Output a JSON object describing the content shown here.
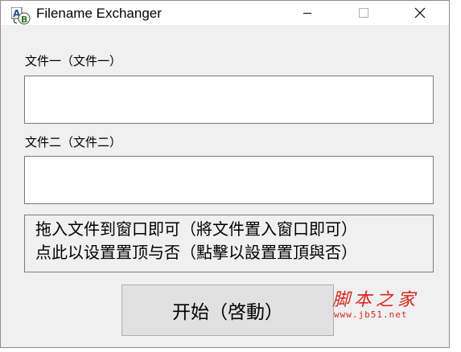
{
  "window": {
    "title": "Filename Exchanger",
    "icon": "app-ab-icon",
    "controls": [
      "minimize-icon",
      "maximize-icon",
      "close-icon"
    ]
  },
  "form": {
    "file1_label": "文件一（文件一）",
    "file1_value": "",
    "file2_label": "文件二（文件二）",
    "file2_value": ""
  },
  "info": {
    "line1": "拖入文件到窗口即可（將文件置入窗口即可）",
    "line2": "点此以设置置顶与否（點擊以設置置頂與否）"
  },
  "actions": {
    "start_label": "开始（啓動）"
  },
  "watermark": {
    "text": "脚本之家",
    "url": "www.jb51.net"
  },
  "colors": {
    "window_bg": "#f0f0f0",
    "button_bg": "#e1e1e1",
    "watermark": "#d7261e"
  }
}
